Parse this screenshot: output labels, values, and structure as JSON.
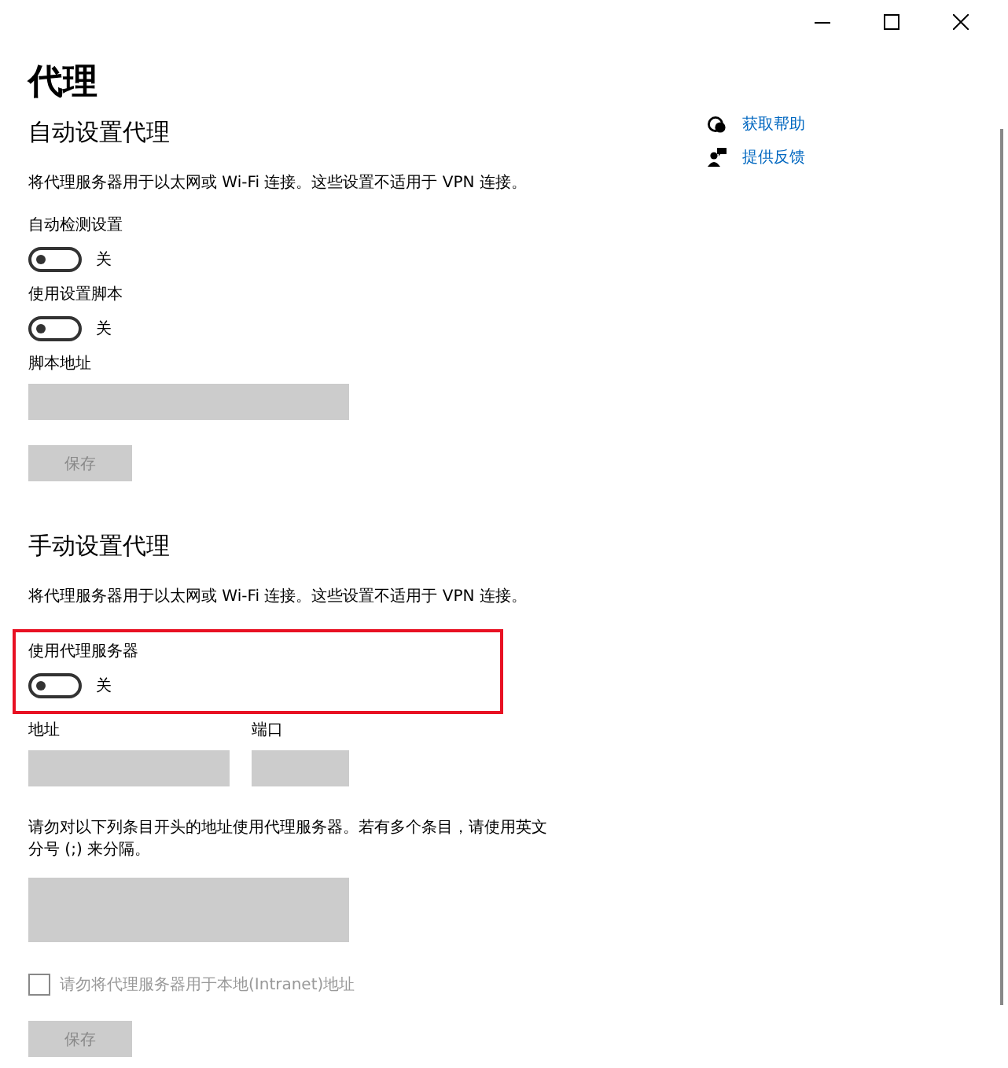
{
  "page_title": "代理",
  "side_links": [
    {
      "kind": "help",
      "label": "获取帮助"
    },
    {
      "kind": "feedback",
      "label": "提供反馈"
    }
  ],
  "sections": [
    {
      "heading": "自动设置代理",
      "description": "将代理服务器用于以太网或 Wi-Fi 连接。这些设置不适用于 VPN 连接。",
      "items": [
        {
          "kind": "toggle",
          "label": "自动检测设置",
          "on": false,
          "state_label": "关",
          "highlighted": false
        },
        {
          "kind": "toggle",
          "label": "使用设置脚本",
          "on": false,
          "state_label": "关",
          "highlighted": false
        },
        {
          "kind": "field",
          "label": "脚本地址",
          "disabled": true
        },
        {
          "kind": "button",
          "label": "保存",
          "disabled": true
        }
      ]
    },
    {
      "heading": "手动设置代理",
      "description": "将代理服务器用于以太网或 Wi-Fi 连接。这些设置不适用于 VPN 连接。",
      "items": [
        {
          "kind": "toggle",
          "label": "使用代理服务器",
          "on": false,
          "state_label": "关",
          "highlighted": true
        },
        {
          "kind": "field_pair",
          "fields": [
            {
              "label": "地址",
              "disabled": true
            },
            {
              "label": "端口",
              "disabled": true
            }
          ]
        },
        {
          "kind": "textarea",
          "label": "请勿对以下列条目开头的地址使用代理服务器。若有多个条目，请使用英文分号 (;) 来分隔。",
          "disabled": true
        },
        {
          "kind": "checkbox",
          "label": "请勿将代理服务器用于本地(Intranet)地址",
          "checked": false,
          "disabled": true
        },
        {
          "kind": "button",
          "label": "保存",
          "disabled": true
        }
      ]
    }
  ]
}
